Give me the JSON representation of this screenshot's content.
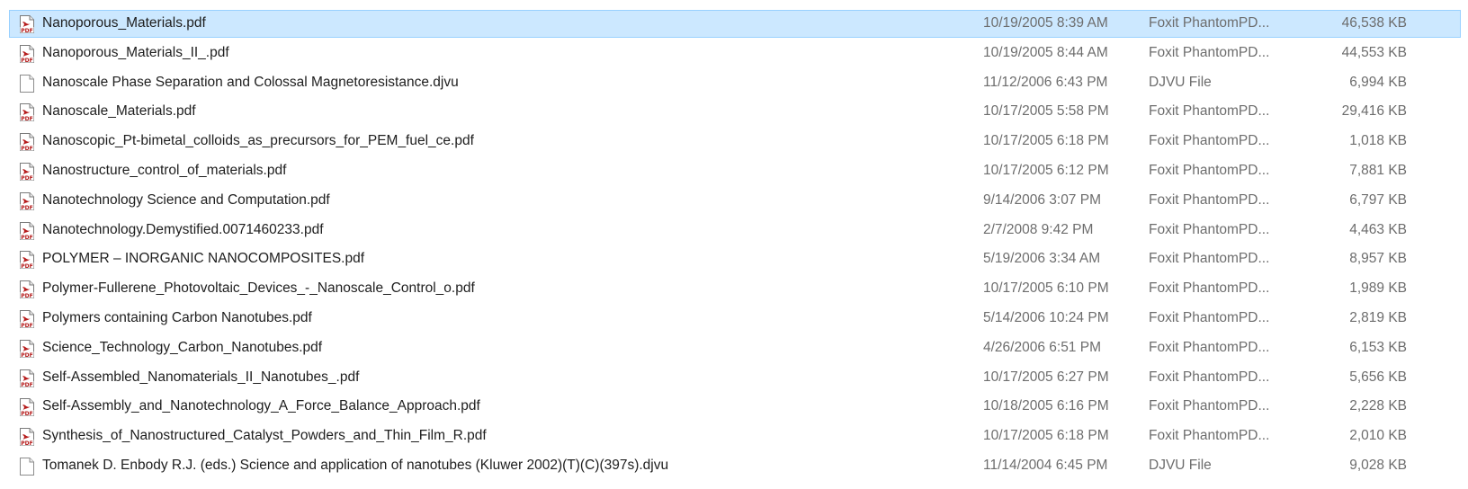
{
  "colors": {
    "selection_fill": "#cce8ff",
    "selection_border": "#99d1ff",
    "pdf_icon_accent": "#b51a1a",
    "secondary_text": "#6d6d6d"
  },
  "files": [
    {
      "name": "Nanoporous_Materials.pdf",
      "date": "10/19/2005 8:39 AM",
      "type": "Foxit PhantomPD...",
      "size": "46,538 KB",
      "icon": "pdf-icon",
      "selected": true
    },
    {
      "name": "Nanoporous_Materials_II_.pdf",
      "date": "10/19/2005 8:44 AM",
      "type": "Foxit PhantomPD...",
      "size": "44,553 KB",
      "icon": "pdf-icon",
      "selected": false
    },
    {
      "name": "Nanoscale Phase  Separation and Colossal  Magnetoresistance.djvu",
      "date": "11/12/2006 6:43 PM",
      "type": "DJVU File",
      "size": "6,994 KB",
      "icon": "file-icon",
      "selected": false
    },
    {
      "name": "Nanoscale_Materials.pdf",
      "date": "10/17/2005 5:58 PM",
      "type": "Foxit PhantomPD...",
      "size": "29,416 KB",
      "icon": "pdf-icon",
      "selected": false
    },
    {
      "name": "Nanoscopic_Pt-bimetal_colloids_as_precursors_for_PEM_fuel_ce.pdf",
      "date": "10/17/2005 6:18 PM",
      "type": "Foxit PhantomPD...",
      "size": "1,018 KB",
      "icon": "pdf-icon",
      "selected": false
    },
    {
      "name": "Nanostructure_control_of_materials.pdf",
      "date": "10/17/2005 6:12 PM",
      "type": "Foxit PhantomPD...",
      "size": "7,881 KB",
      "icon": "pdf-icon",
      "selected": false
    },
    {
      "name": "Nanotechnology Science and Computation.pdf",
      "date": "9/14/2006 3:07 PM",
      "type": "Foxit PhantomPD...",
      "size": "6,797 KB",
      "icon": "pdf-icon",
      "selected": false
    },
    {
      "name": "Nanotechnology.Demystified.0071460233.pdf",
      "date": "2/7/2008 9:42 PM",
      "type": "Foxit PhantomPD...",
      "size": "4,463 KB",
      "icon": "pdf-icon",
      "selected": false
    },
    {
      "name": "POLYMER – INORGANIC NANOCOMPOSITES.pdf",
      "date": "5/19/2006 3:34 AM",
      "type": "Foxit PhantomPD...",
      "size": "8,957 KB",
      "icon": "pdf-icon",
      "selected": false
    },
    {
      "name": "Polymer-Fullerene_Photovoltaic_Devices_-_Nanoscale_Control_o.pdf",
      "date": "10/17/2005 6:10 PM",
      "type": "Foxit PhantomPD...",
      "size": "1,989 KB",
      "icon": "pdf-icon",
      "selected": false
    },
    {
      "name": "Polymers containing Carbon Nanotubes.pdf",
      "date": "5/14/2006 10:24 PM",
      "type": "Foxit PhantomPD...",
      "size": "2,819 KB",
      "icon": "pdf-icon",
      "selected": false
    },
    {
      "name": "Science_Technology_Carbon_Nanotubes.pdf",
      "date": "4/26/2006 6:51 PM",
      "type": "Foxit PhantomPD...",
      "size": "6,153 KB",
      "icon": "pdf-icon",
      "selected": false
    },
    {
      "name": "Self-Assembled_Nanomaterials_II_Nanotubes_.pdf",
      "date": "10/17/2005 6:27 PM",
      "type": "Foxit PhantomPD...",
      "size": "5,656 KB",
      "icon": "pdf-icon",
      "selected": false
    },
    {
      "name": "Self-Assembly_and_Nanotechnology_A_Force_Balance_Approach.pdf",
      "date": "10/18/2005 6:16 PM",
      "type": "Foxit PhantomPD...",
      "size": "2,228 KB",
      "icon": "pdf-icon",
      "selected": false
    },
    {
      "name": "Synthesis_of_Nanostructured_Catalyst_Powders_and_Thin_Film_R.pdf",
      "date": "10/17/2005 6:18 PM",
      "type": "Foxit PhantomPD...",
      "size": "2,010 KB",
      "icon": "pdf-icon",
      "selected": false
    },
    {
      "name": "Tomanek D. Enbody R.J. (eds.) Science and application of nanotubes (Kluwer 2002)(T)(C)(397s).djvu",
      "date": "11/14/2004 6:45 PM",
      "type": "DJVU File",
      "size": "9,028 KB",
      "icon": "file-icon",
      "selected": false
    }
  ]
}
